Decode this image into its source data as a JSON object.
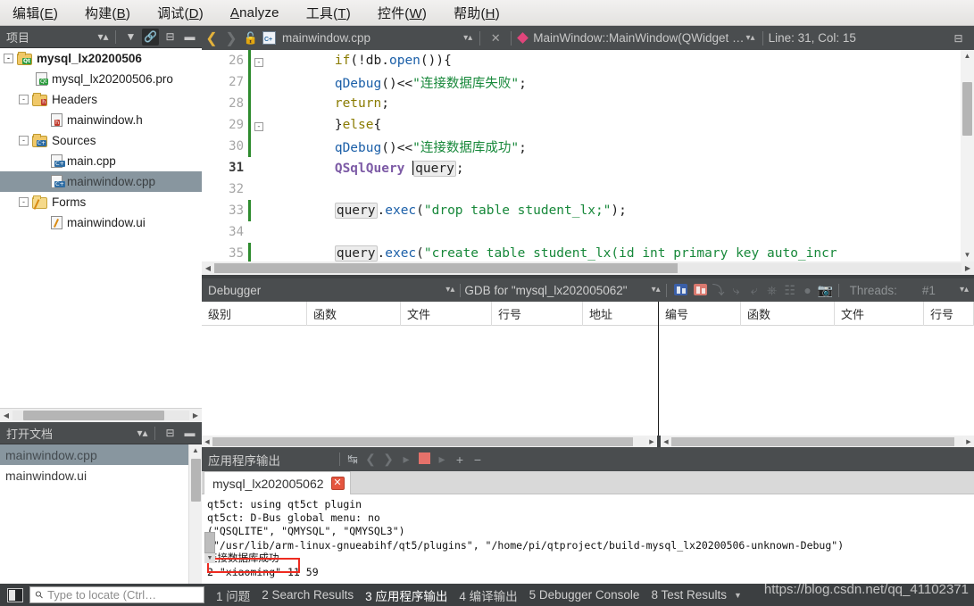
{
  "menubar": {
    "items": [
      {
        "label": "编辑(E)",
        "mnemonic": "E"
      },
      {
        "label": "构建(B)",
        "mnemonic": "B"
      },
      {
        "label": "调试(D)",
        "mnemonic": "D"
      },
      {
        "label": "Analyze",
        "mnemonic": "A"
      },
      {
        "label": "工具(T)",
        "mnemonic": "T"
      },
      {
        "label": "控件(W)",
        "mnemonic": "W"
      },
      {
        "label": "帮助(H)",
        "mnemonic": "H"
      }
    ]
  },
  "project_panel": {
    "title": "项目",
    "tree": [
      {
        "label": "mysql_lx20200506",
        "depth": 0,
        "icon": "folder-qt",
        "expander": "-",
        "bold": true,
        "selected": false
      },
      {
        "label": "mysql_lx20200506.pro",
        "depth": 1,
        "icon": "file-qt",
        "expander": "",
        "bold": false,
        "selected": false
      },
      {
        "label": "Headers",
        "depth": 1,
        "icon": "folder-h",
        "expander": "-",
        "bold": false,
        "selected": false
      },
      {
        "label": "mainwindow.h",
        "depth": 2,
        "icon": "file-h",
        "expander": "",
        "bold": false,
        "selected": false
      },
      {
        "label": "Sources",
        "depth": 1,
        "icon": "folder-cpp",
        "expander": "-",
        "bold": false,
        "selected": false
      },
      {
        "label": "main.cpp",
        "depth": 2,
        "icon": "file-cpp",
        "expander": "",
        "bold": false,
        "selected": false
      },
      {
        "label": "mainwindow.cpp",
        "depth": 2,
        "icon": "file-cpp",
        "expander": "",
        "bold": false,
        "selected": true
      },
      {
        "label": "Forms",
        "depth": 1,
        "icon": "folder-form",
        "expander": "-",
        "bold": false,
        "selected": false
      },
      {
        "label": "mainwindow.ui",
        "depth": 2,
        "icon": "file-ui",
        "expander": "",
        "bold": false,
        "selected": false
      }
    ]
  },
  "open_documents": {
    "title": "打开文档",
    "items": [
      {
        "label": "mainwindow.cpp",
        "selected": true
      },
      {
        "label": "mainwindow.ui",
        "selected": false
      }
    ]
  },
  "editor_toolbar": {
    "filename": "mainwindow.cpp",
    "symbol": "MainWindow::MainWindow(QWidget …",
    "cursor_position": "Line: 31, Col: 15"
  },
  "editor": {
    "lines": [
      {
        "num": "26",
        "fold": "-",
        "mark": true,
        "current": false,
        "tokens": [
          {
            "t": "        ",
            "c": "plain"
          },
          {
            "t": "if",
            "c": "kw2"
          },
          {
            "t": "(!",
            "c": "plain"
          },
          {
            "t": "db",
            "c": "plain"
          },
          {
            "t": ".",
            "c": "plain"
          },
          {
            "t": "open",
            "c": "fn"
          },
          {
            "t": "()){",
            "c": "plain"
          }
        ]
      },
      {
        "num": "27",
        "fold": "",
        "mark": true,
        "current": false,
        "tokens": [
          {
            "t": "        ",
            "c": "plain"
          },
          {
            "t": "qDebug",
            "c": "fn"
          },
          {
            "t": "()",
            "c": "plain"
          },
          {
            "t": "<<",
            "c": "plain"
          },
          {
            "t": "\"连接数据库失败\"",
            "c": "str"
          },
          {
            "t": ";",
            "c": "plain"
          }
        ]
      },
      {
        "num": "28",
        "fold": "",
        "mark": true,
        "current": false,
        "tokens": [
          {
            "t": "        ",
            "c": "plain"
          },
          {
            "t": "return",
            "c": "kw2"
          },
          {
            "t": ";",
            "c": "plain"
          }
        ]
      },
      {
        "num": "29",
        "fold": "-",
        "mark": true,
        "current": false,
        "tokens": [
          {
            "t": "        }",
            "c": "plain"
          },
          {
            "t": "else",
            "c": "kw2"
          },
          {
            "t": "{",
            "c": "plain"
          }
        ]
      },
      {
        "num": "30",
        "fold": "",
        "mark": true,
        "current": false,
        "tokens": [
          {
            "t": "        ",
            "c": "plain"
          },
          {
            "t": "qDebug",
            "c": "fn"
          },
          {
            "t": "()",
            "c": "plain"
          },
          {
            "t": "<<",
            "c": "plain"
          },
          {
            "t": "\"连接数据库成功\"",
            "c": "str"
          },
          {
            "t": ";",
            "c": "plain"
          }
        ]
      },
      {
        "num": "31",
        "fold": "",
        "mark": false,
        "current": true,
        "tokens": [
          {
            "t": "        ",
            "c": "plain"
          },
          {
            "t": "QSqlQuery",
            "c": "kw"
          },
          {
            "t": " ",
            "c": "plain"
          },
          {
            "t": "query",
            "c": "tok-hl"
          },
          {
            "t": ";",
            "c": "plain"
          }
        ]
      },
      {
        "num": "32",
        "fold": "",
        "mark": false,
        "current": false,
        "tokens": []
      },
      {
        "num": "33",
        "fold": "",
        "mark": true,
        "current": false,
        "tokens": [
          {
            "t": "        ",
            "c": "plain"
          },
          {
            "t": "query",
            "c": "tok-hl"
          },
          {
            "t": ".",
            "c": "plain"
          },
          {
            "t": "exec",
            "c": "fn"
          },
          {
            "t": "(",
            "c": "plain"
          },
          {
            "t": "\"drop table student_lx;\"",
            "c": "str"
          },
          {
            "t": ");",
            "c": "plain"
          }
        ]
      },
      {
        "num": "34",
        "fold": "",
        "mark": false,
        "current": false,
        "tokens": []
      },
      {
        "num": "35",
        "fold": "",
        "mark": true,
        "current": false,
        "tokens": [
          {
            "t": "        ",
            "c": "plain"
          },
          {
            "t": "query",
            "c": "tok-hl"
          },
          {
            "t": ".",
            "c": "plain"
          },
          {
            "t": "exec",
            "c": "fn"
          },
          {
            "t": "(",
            "c": "plain"
          },
          {
            "t": "\"create table student_lx(id int primary key auto_incr",
            "c": "str"
          }
        ]
      }
    ]
  },
  "debugger": {
    "title": "Debugger",
    "engine": "GDB for \"mysql_lx202005062\"",
    "threads_label": "Threads:",
    "threads_value": "#1",
    "left_columns": [
      "级别",
      "函数",
      "文件",
      "行号",
      "地址"
    ],
    "right_columns": [
      "编号",
      "函数",
      "文件",
      "行号"
    ]
  },
  "app_output": {
    "title": "应用程序输出",
    "tab_label": "mysql_lx202005062",
    "lines": [
      "qt5ct: using qt5ct plugin",
      "qt5ct: D-Bus global menu: no",
      "(\"QSQLITE\", \"QMYSQL\", \"QMYSQL3\")",
      "(\"/usr/lib/arm-linux-gnueabihf/qt5/plugins\", \"/home/pi/qtproject/build-mysql_lx20200506-unknown-Debug\")",
      "连接数据库成功",
      "2 \"xiaoming\" 11 59"
    ],
    "highlight_line_index": 4
  },
  "statusbar": {
    "locate_placeholder": "Type to locate (Ctrl…",
    "items": [
      {
        "num": "1",
        "label": "问题",
        "active": false
      },
      {
        "num": "2",
        "label": "Search Results",
        "active": false
      },
      {
        "num": "3",
        "label": "应用程序输出",
        "active": true
      },
      {
        "num": "4",
        "label": "编译输出",
        "active": false
      },
      {
        "num": "5",
        "label": "Debugger Console",
        "active": false
      },
      {
        "num": "8",
        "label": "Test Results",
        "active": false
      }
    ]
  },
  "watermark": "https://blog.csdn.net/qq_41102371",
  "colors": {
    "menubar_bg": "#ecebe9",
    "panel_header_bg": "#4a4d4f",
    "selection_bg": "#88969f",
    "accent_red": "#ee2b20",
    "symbol_pink": "#e0457b",
    "string_green": "#17883a"
  }
}
